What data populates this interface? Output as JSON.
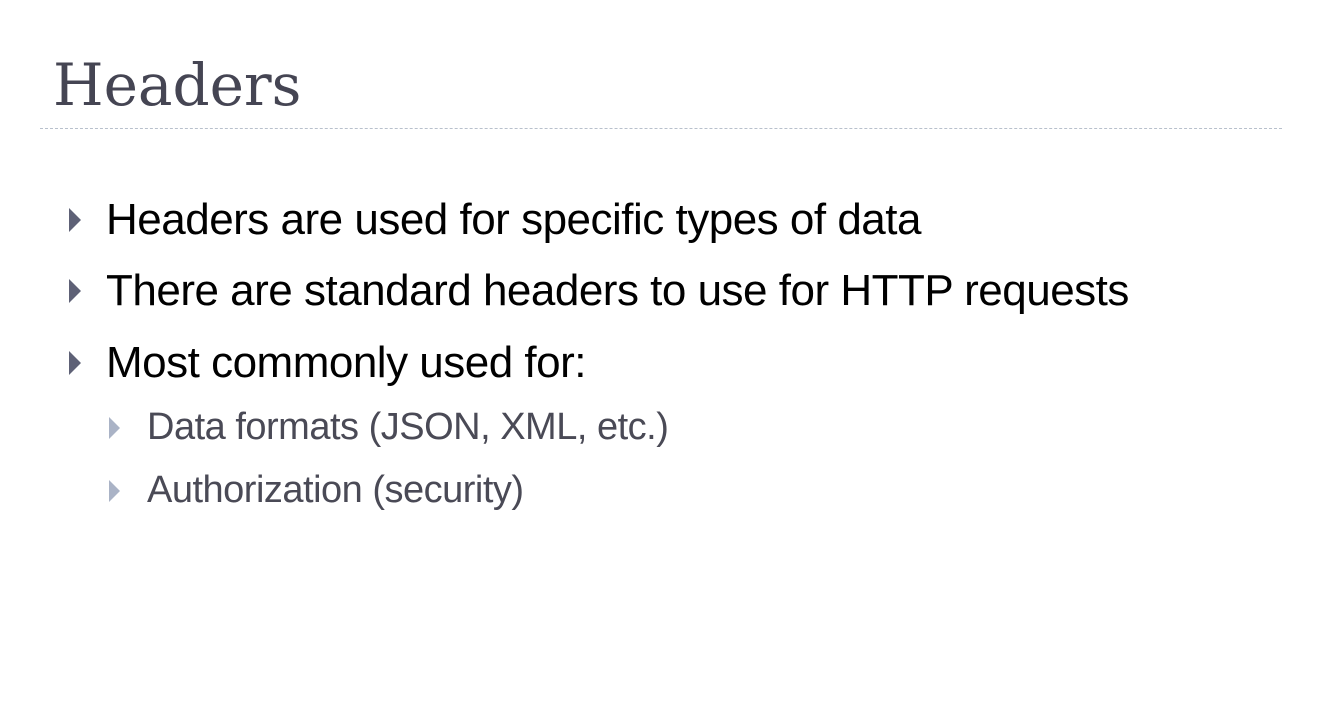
{
  "slide": {
    "title": "Headers",
    "bullets": [
      {
        "level": 1,
        "text": "Headers are used for specific types of data"
      },
      {
        "level": 1,
        "text": "There are standard headers to use for HTTP requests"
      },
      {
        "level": 1,
        "text": "Most commonly used for:"
      },
      {
        "level": 2,
        "text": "Data formats (JSON, XML, etc.)"
      },
      {
        "level": 2,
        "text": "Authorization (security)"
      }
    ]
  },
  "icons": {
    "bullet_marker": "triangle-right-icon"
  },
  "colors": {
    "title": "#454553",
    "body_text": "#000000",
    "sub_text": "#4a4a56",
    "marker_level1": "#5e6176",
    "marker_level2": "#aab3c6",
    "divider": "#b8c0cc"
  }
}
